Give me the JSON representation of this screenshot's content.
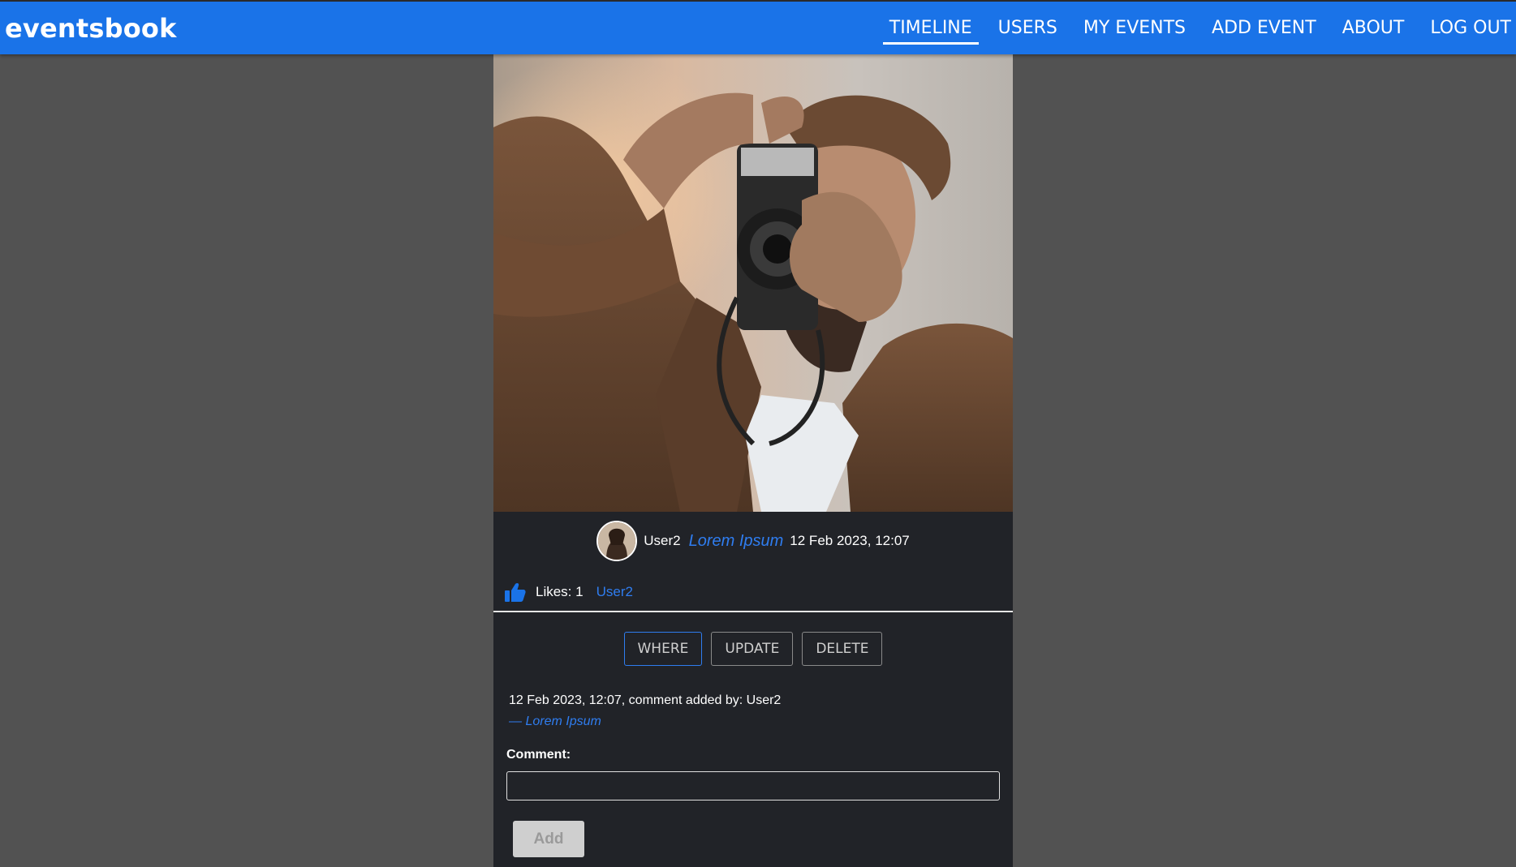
{
  "brand": "eventsbook",
  "nav": {
    "items": [
      {
        "label": "TIMELINE",
        "active": true
      },
      {
        "label": "USERS"
      },
      {
        "label": "MY EVENTS"
      },
      {
        "label": "ADD EVENT"
      },
      {
        "label": "ABOUT"
      },
      {
        "label": "LOG OUT"
      }
    ]
  },
  "event": {
    "author": "User2",
    "title": "Lorem Ipsum",
    "date": "12 Feb 2023, 12:07",
    "likes_label": "Likes: 1",
    "liked_by": "User2"
  },
  "actions": {
    "where": "WHERE",
    "update": "UPDATE",
    "delete": "DELETE"
  },
  "comment": {
    "info": "12 Feb 2023, 12:07, comment added by: User2",
    "quote": "— Lorem Ipsum",
    "label": "Comment:",
    "input_value": "",
    "add_label": "Add"
  },
  "colors": {
    "navbar": "#1a73e8",
    "accent": "#2f7df0",
    "page_bg": "#525252",
    "card_bg": "#212328"
  },
  "icons": {
    "like": "thumbs-up-icon"
  }
}
